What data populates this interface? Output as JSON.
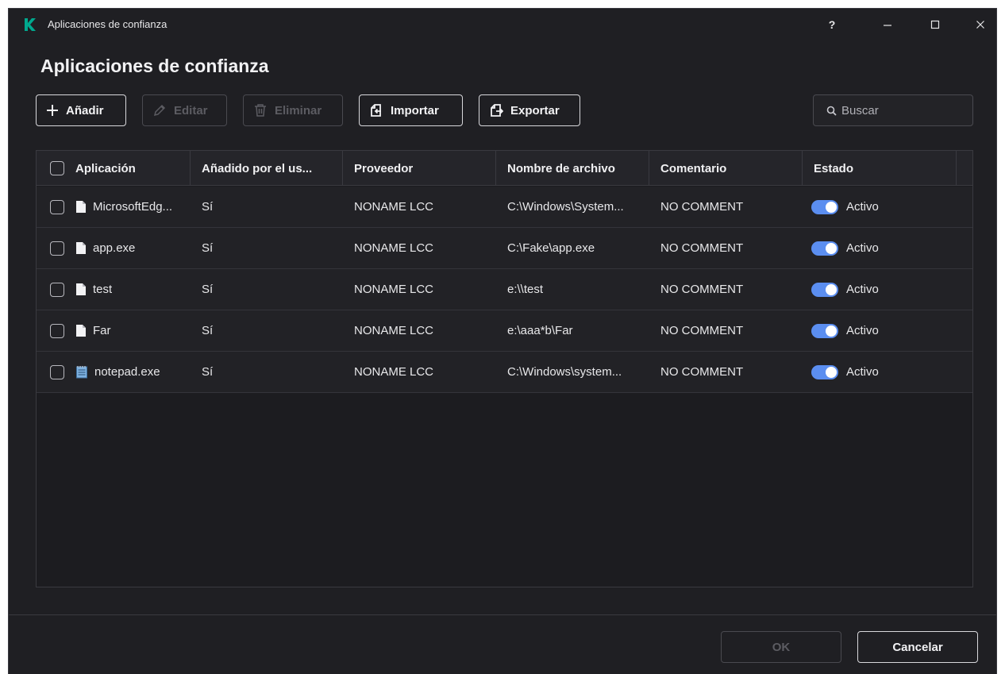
{
  "window": {
    "title": "Aplicaciones de confianza",
    "help_label": "?"
  },
  "page": {
    "title": "Aplicaciones de confianza"
  },
  "toolbar": {
    "add_label": "Añadir",
    "edit_label": "Editar",
    "delete_label": "Eliminar",
    "import_label": "Importar",
    "export_label": "Exportar",
    "edit_enabled": false,
    "delete_enabled": false
  },
  "search": {
    "placeholder": "Buscar",
    "value": ""
  },
  "table": {
    "columns": [
      "Aplicación",
      "Añadido por el us...",
      "Proveedor",
      "Nombre de archivo",
      "Comentario",
      "Estado"
    ],
    "rows": [
      {
        "app": "MicrosoftEdg...",
        "added_by_user": "Sí",
        "vendor": "NONAME LCC",
        "file": "C:\\Windows\\System...",
        "comment": "NO COMMENT",
        "status": "Activo",
        "icon": "file-icon"
      },
      {
        "app": "app.exe",
        "added_by_user": "Sí",
        "vendor": "NONAME LCC",
        "file": "C:\\Fake\\app.exe",
        "comment": "NO COMMENT",
        "status": "Activo",
        "icon": "file-icon"
      },
      {
        "app": "test",
        "added_by_user": "Sí",
        "vendor": "NONAME LCC",
        "file": "e:\\\\test",
        "comment": "NO COMMENT",
        "status": "Activo",
        "icon": "file-icon"
      },
      {
        "app": "Far",
        "added_by_user": "Sí",
        "vendor": "NONAME LCC",
        "file": "e:\\aaa*b\\Far",
        "comment": "NO COMMENT",
        "status": "Activo",
        "icon": "file-icon"
      },
      {
        "app": "notepad.exe",
        "added_by_user": "Sí",
        "vendor": "NONAME LCC",
        "file": "C:\\Windows\\system...",
        "comment": "NO COMMENT",
        "status": "Activo",
        "icon": "notepad-icon"
      }
    ]
  },
  "footer": {
    "ok_label": "OK",
    "cancel_label": "Cancelar",
    "ok_enabled": false
  },
  "colors": {
    "background": "#1f1f23",
    "accent_toggle": "#5b8ef0",
    "brand_logo": "#00a88e"
  }
}
